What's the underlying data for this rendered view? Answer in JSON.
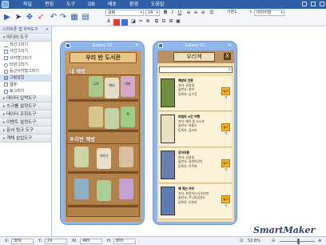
{
  "menu": {
    "items": [
      "파일",
      "편집",
      "도구",
      "DB",
      "배포",
      "환경",
      "도움말"
    ]
  },
  "toolbar": {
    "font_name": "굴림",
    "font_size": "24",
    "font_preset": "기본1",
    "align_preset": "이미지형"
  },
  "sidebar": {
    "title": "스마트폰 앱 저작도구",
    "categories": [
      {
        "label": "미디어 도구",
        "open": true,
        "items": [
          "직선그리기",
          "사선그리기",
          "사각형그리기",
          "타원그리기",
          "둥근사각형그리기",
          "그림삽입",
          "웹뷰",
          "표그리기"
        ]
      },
      {
        "label": "데이터 입력도구"
      },
      {
        "label": "스크롤 설정도구"
      },
      {
        "label": "데이터 조회도구"
      },
      {
        "label": "이벤트 설정도구"
      },
      {
        "label": "문서 링크 도구"
      },
      {
        "label": "객체 삽입도구"
      }
    ]
  },
  "phone1": {
    "device": "Galaxy S2",
    "banner": "우리 반 도서관",
    "label_my": "내 책방",
    "label_class": "우리반 책방",
    "books_row1": [
      "니모",
      "해리",
      "빅마"
    ],
    "books_row2": [
      "",
      "",
      "책"
    ],
    "books_row3": [
      "",
      "이야기",
      ""
    ],
    "books_row4": [
      "",
      "",
      ""
    ]
  },
  "phone2": {
    "device": "Galaxy S2",
    "title": "우리책",
    "close": "X",
    "items": [
      {
        "title": "해방의 연못",
        "l1": "저자: 권정생",
        "l2": "출판사: 창비",
        "l3": "등록자: 김우진",
        "rent": "빌리기"
      },
      {
        "title": "마법의 시간 여행",
        "l1": "저자: 메리 폽 오스본",
        "l2": "출판사: 비룡소",
        "l3": "등록자: 김지호",
        "rent": "빌리기"
      },
      {
        "title": "강아지똥",
        "l1": "저자: 권정생",
        "l2": "출판사: 길벗어린이",
        "l3": "등록자: 이주원",
        "rent": "빌리기"
      },
      {
        "title": "책 먹는 여우",
        "l1": "저자: 프란치스카 비어만",
        "l2": "출판사: 주니어김영사",
        "l3": "등록자: 오현지",
        "rent": "빌리기"
      }
    ]
  },
  "logo": "SmartMaker",
  "status": {
    "x": "309",
    "y": "24",
    "w": "480",
    "h": "800",
    "zoom": "52.6%"
  }
}
